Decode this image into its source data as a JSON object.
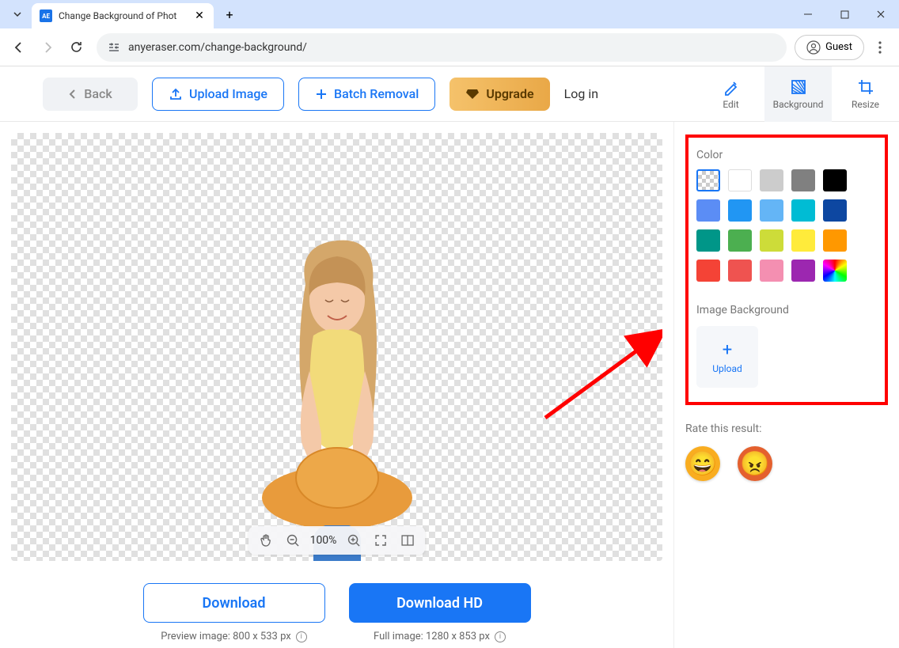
{
  "browser": {
    "tab_title": "Change Background of Phot",
    "tab_favicon": "AE",
    "url": "anyeraser.com/change-background/",
    "guest_label": "Guest"
  },
  "toolbar": {
    "back_label": "Back",
    "upload_label": "Upload Image",
    "batch_label": "Batch Removal",
    "upgrade_label": "Upgrade",
    "login_label": "Log in"
  },
  "modes": {
    "edit": "Edit",
    "background": "Background",
    "resize": "Resize"
  },
  "zoom": {
    "level": "100%"
  },
  "downloads": {
    "standard_label": "Download",
    "hd_label": "Download HD",
    "preview_meta": "Preview image: 800 x 533 px",
    "full_meta": "Full image: 1280 x 853 px"
  },
  "sidebar": {
    "color_title": "Color",
    "colors": [
      "transparent",
      "#ffffff",
      "#cccccc",
      "#808080",
      "#000000",
      "#5b8df5",
      "#2196f3",
      "#64b5f6",
      "#00bcd4",
      "#0d47a1",
      "#009688",
      "#4caf50",
      "#cddc39",
      "#ffeb3b",
      "#ff9800",
      "#f44336",
      "#ef5350",
      "#f48fb1",
      "#9c27b0",
      "rainbow"
    ],
    "image_bg_title": "Image Background",
    "upload_label": "Upload",
    "rate_title": "Rate this result:"
  }
}
